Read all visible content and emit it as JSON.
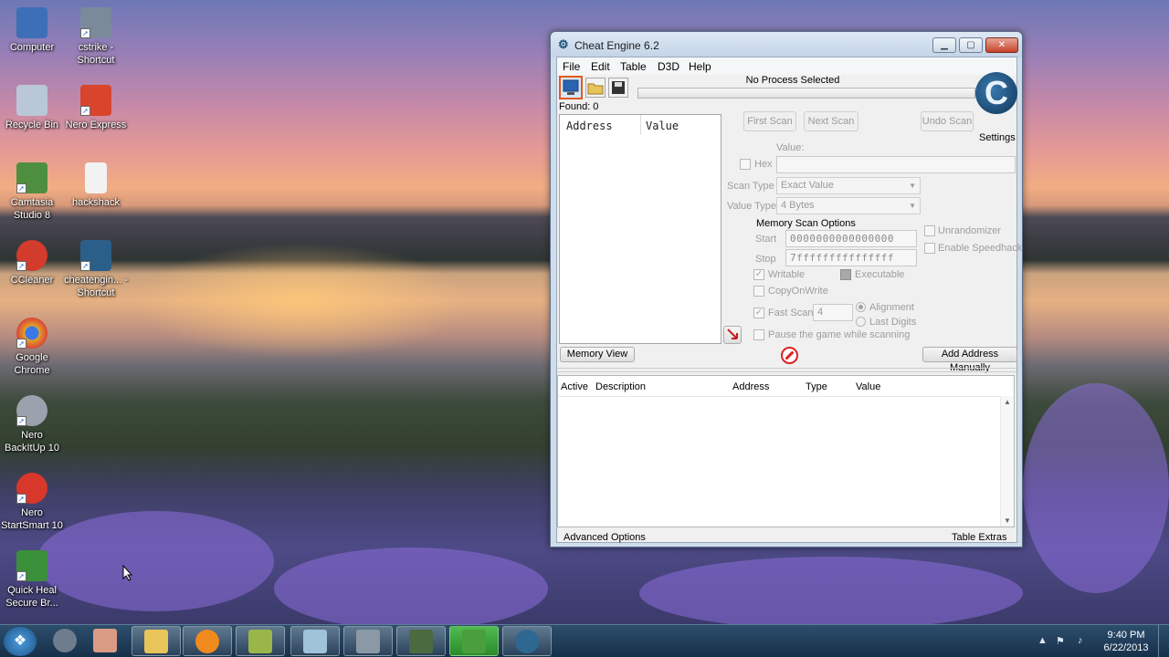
{
  "desktop": {
    "icons": [
      {
        "label": "Computer",
        "icon": "computer-icon",
        "color": "#3d6fb8"
      },
      {
        "label": "cstrike - Shortcut",
        "icon": "cstrike-icon",
        "color": "#7a8a9a"
      },
      {
        "label": "Recycle Bin",
        "icon": "recycle-bin-icon",
        "color": "#b9c7d8"
      },
      {
        "label": "Nero Express",
        "icon": "nero-express-icon",
        "color": "#d9452c"
      },
      {
        "label": "Camtasia Studio 8",
        "icon": "camtasia-icon",
        "color": "#4d8f3f"
      },
      {
        "label": "hackshack",
        "icon": "document-icon",
        "color": "#f2f2f2"
      },
      {
        "label": "CCleaner",
        "icon": "ccleaner-icon",
        "color": "#d33b2c"
      },
      {
        "label": "cheatengin... - Shortcut",
        "icon": "cheat-engine-icon",
        "color": "#2b5f8a"
      },
      {
        "label": "Google Chrome",
        "icon": "chrome-icon",
        "color": "#e2a329"
      },
      {
        "label": "Nero BackItUp 10",
        "icon": "nero-backitup-icon",
        "color": "#9aa3ad"
      },
      {
        "label": "Nero StartSmart 10",
        "icon": "nero-startsmart-icon",
        "color": "#d8382b"
      },
      {
        "label": "Quick Heal Secure Br...",
        "icon": "quick-heal-icon",
        "color": "#3a8f3a"
      }
    ]
  },
  "window": {
    "title": "Cheat Engine 6.2",
    "controls": {
      "minimize": "▁",
      "maximize": "▢",
      "close": "✕"
    }
  },
  "menu": [
    "File",
    "Edit",
    "Table",
    "D3D",
    "Help"
  ],
  "toolbar": {
    "open_process_icon": "computer-select-icon",
    "open_file_icon": "folder-open-icon",
    "save_icon": "floppy-disk-icon"
  },
  "process_label": "No Process Selected",
  "found_label": "Found: 0",
  "logo_letter": "C",
  "settings_label": "Settings",
  "results": {
    "columns": [
      "Address",
      "Value"
    ]
  },
  "scan": {
    "first_scan": "First Scan",
    "next_scan": "Next Scan",
    "undo_scan": "Undo Scan",
    "value_label": "Value:",
    "hex_label": "Hex",
    "scan_type_label": "Scan Type",
    "scan_type_value": "Exact Value",
    "value_type_label": "Value Type",
    "value_type_value": "4 Bytes",
    "memory_options_label": "Memory Scan Options",
    "start_label": "Start",
    "start_value": "0000000000000000",
    "stop_label": "Stop",
    "stop_value": "7fffffffffffffff",
    "writable": "Writable",
    "executable": "Executable",
    "copy_on_write": "CopyOnWrite",
    "fast_scan": "Fast Scan",
    "fast_scan_value": "4",
    "alignment": "Alignment",
    "last_digits": "Last Digits",
    "pause_game": "Pause the game while scanning",
    "unrandomizer": "Unrandomizer",
    "enable_speedhack": "Enable Speedhack"
  },
  "buttons": {
    "memory_view": "Memory View",
    "add_address": "Add Address Manually"
  },
  "address_list": {
    "columns": [
      "Active",
      "Description",
      "Address",
      "Type",
      "Value"
    ]
  },
  "footer": {
    "advanced_options": "Advanced Options",
    "table_extras": "Table Extras"
  },
  "taskbar": {
    "apps": [
      {
        "name": "media-center-icon",
        "color": "#6d7d8e"
      },
      {
        "name": "game-avatar-icon",
        "color": "#d99b84"
      },
      {
        "name": "file-explorer-icon",
        "color": "#e9c45a"
      },
      {
        "name": "media-player-icon",
        "color": "#f08a1c"
      },
      {
        "name": "camtasia-recorder-icon",
        "color": "#9ab64a"
      },
      {
        "name": "virtualbox-icon",
        "color": "#9fc3d9"
      },
      {
        "name": "cstrike-task-icon",
        "color": "#8b98a6"
      },
      {
        "name": "camtasia-studio-icon",
        "color": "#4b6b3f"
      },
      {
        "name": "quick-heal-task-icon",
        "color": "#4a9e3b"
      },
      {
        "name": "cheat-engine-task-icon",
        "color": "#2e6791"
      }
    ],
    "time": "9:40 PM",
    "date": "6/22/2013"
  }
}
